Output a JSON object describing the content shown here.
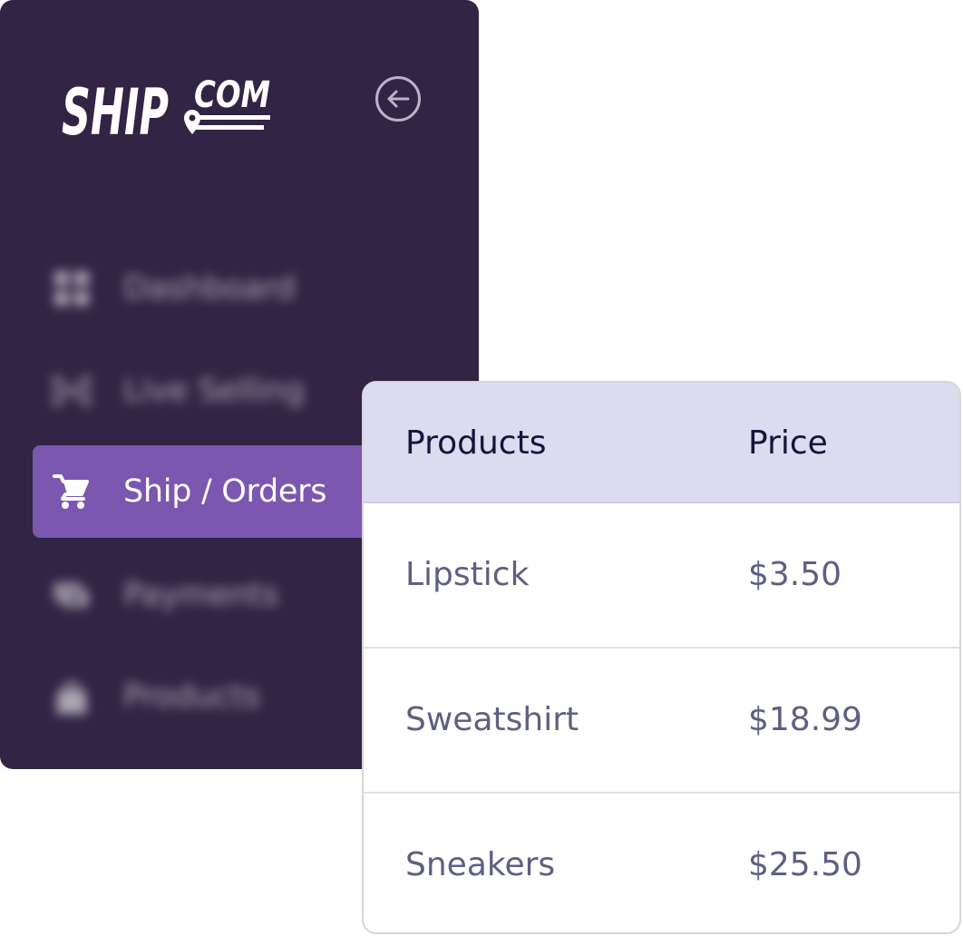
{
  "app": {
    "logo_text_primary": "SHIP",
    "logo_text_secondary": "COM",
    "brand_color": "#312444",
    "accent_color": "#7b57b0"
  },
  "sidebar": {
    "collapse_icon": "arrow-left-circle-icon",
    "items": [
      {
        "label": "Dashboard",
        "icon": "grid-icon",
        "active": false
      },
      {
        "label": "Live Selling",
        "icon": "broadcast-icon",
        "active": false
      },
      {
        "label": "Ship / Orders",
        "icon": "cart-icon",
        "active": true
      },
      {
        "label": "Payments",
        "icon": "payments-icon",
        "active": false
      },
      {
        "label": "Products",
        "icon": "bag-icon",
        "active": false
      }
    ]
  },
  "table": {
    "header_background": "#dcdbef",
    "columns": [
      "Products",
      "Price"
    ],
    "rows": [
      {
        "product": "Lipstick",
        "price": "$3.50"
      },
      {
        "product": "Sweatshirt",
        "price": "$18.99"
      },
      {
        "product": "Sneakers",
        "price": "$25.50"
      }
    ]
  }
}
